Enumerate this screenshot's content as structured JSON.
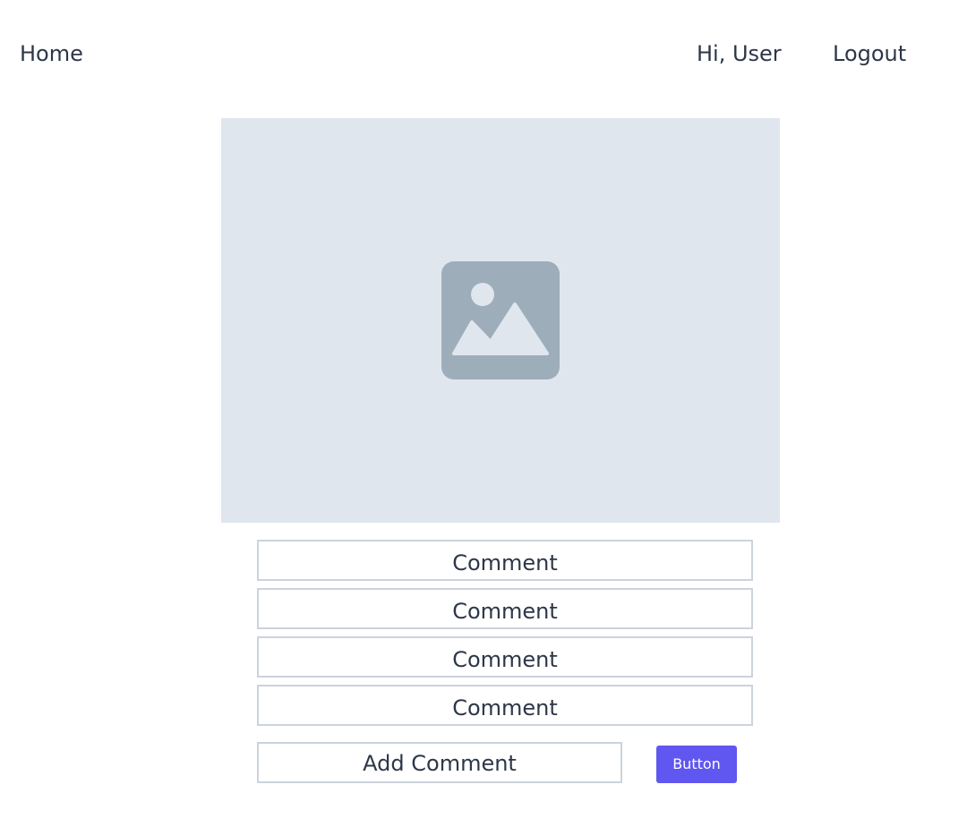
{
  "nav": {
    "home_label": "Home",
    "greeting": "Hi, User",
    "logout_label": "Logout"
  },
  "post": {
    "image_icon": "image-placeholder-icon"
  },
  "comments": [
    {
      "text": "Comment"
    },
    {
      "text": "Comment"
    },
    {
      "text": "Comment"
    },
    {
      "text": "Comment"
    }
  ],
  "add_comment": {
    "placeholder": "Add Comment"
  },
  "submit_button": {
    "label": "Button",
    "color": "#6056f0"
  },
  "colors": {
    "text": "#2d3748",
    "image_background": "#e0e6ee",
    "image_icon": "#9eadba",
    "border": "#cbd3dc"
  }
}
